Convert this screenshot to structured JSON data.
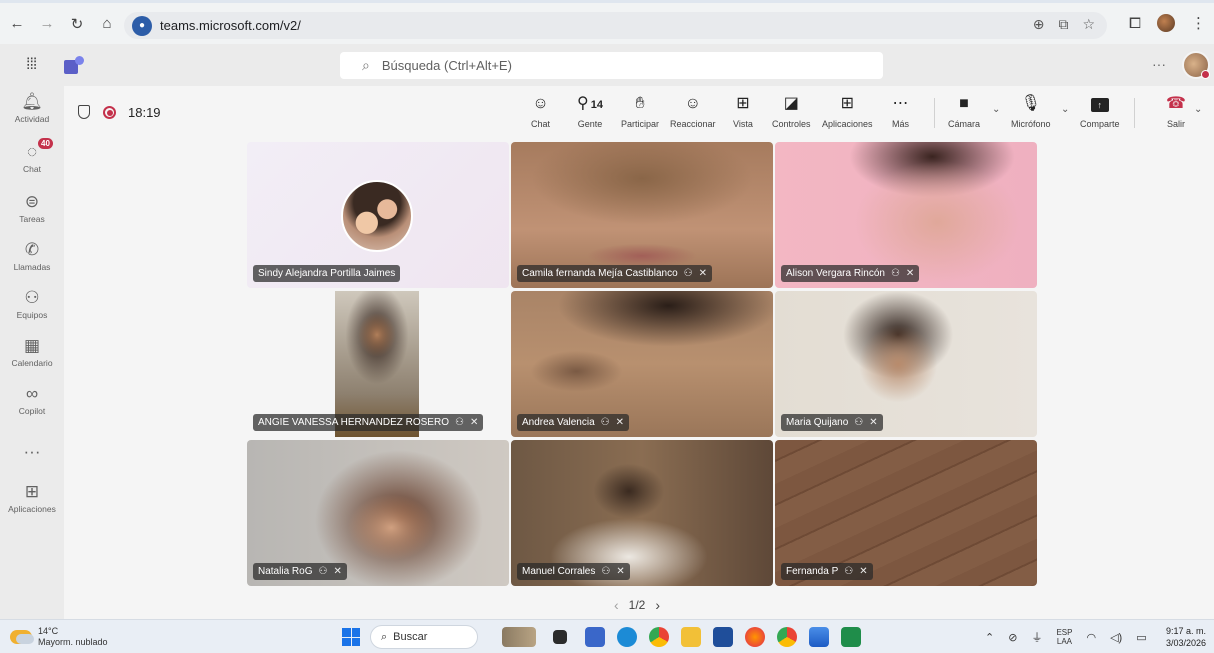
{
  "browser": {
    "url": "teams.microsoft.com/v2/",
    "icons": [
      "back-arrow",
      "forward-arrow",
      "reload",
      "home",
      "zoom",
      "cast",
      "bookmark-star",
      "extensions",
      "profile",
      "menu-dots"
    ]
  },
  "teams_header": {
    "search_placeholder": "Búsqueda (Ctrl+Alt+E)",
    "more": "···"
  },
  "rail": {
    "items": [
      {
        "label": "Actividad",
        "icon": "bell"
      },
      {
        "label": "Chat",
        "icon": "chat",
        "badge": "40"
      },
      {
        "label": "Tareas",
        "icon": "tasks"
      },
      {
        "label": "Llamadas",
        "icon": "phone"
      },
      {
        "label": "Equipos",
        "icon": "teams"
      },
      {
        "label": "Calendario",
        "icon": "calendar"
      },
      {
        "label": "Copilot",
        "icon": "copilot"
      },
      {
        "label": "···",
        "icon": "more"
      },
      {
        "label": "Aplicaciones",
        "icon": "add-apps"
      }
    ]
  },
  "meeting": {
    "timer": "18:19",
    "toolbar": {
      "chat": "Chat",
      "people": "Gente",
      "people_count": "14",
      "raise": "Participar",
      "react": "Reaccionar",
      "view": "Vista",
      "controls": "Controles",
      "apps": "Aplicaciones",
      "more": "Más",
      "camera": "Cámara",
      "mic": "Micrófono",
      "share": "Comparte",
      "leave": "Salir"
    },
    "participants": [
      "Sindy Alejandra Portilla Jaimes",
      "Camila fernanda Mejía Castiblanco",
      "Alison Vergara Rincón",
      "ANGIE VANESSA HERNANDEZ ROSERO",
      "Andrea Valencia",
      "Maria Quijano",
      "Natalia RoG",
      "Manuel Corrales",
      "Fernanda P"
    ],
    "pager": "1/2"
  },
  "taskbar": {
    "temp": "14°C",
    "weather": "Mayorm. nublado",
    "search": "Buscar",
    "lang1": "ESP",
    "lang2": "LAA",
    "time": "9:17 a. m.",
    "date": "3/03/2026"
  }
}
